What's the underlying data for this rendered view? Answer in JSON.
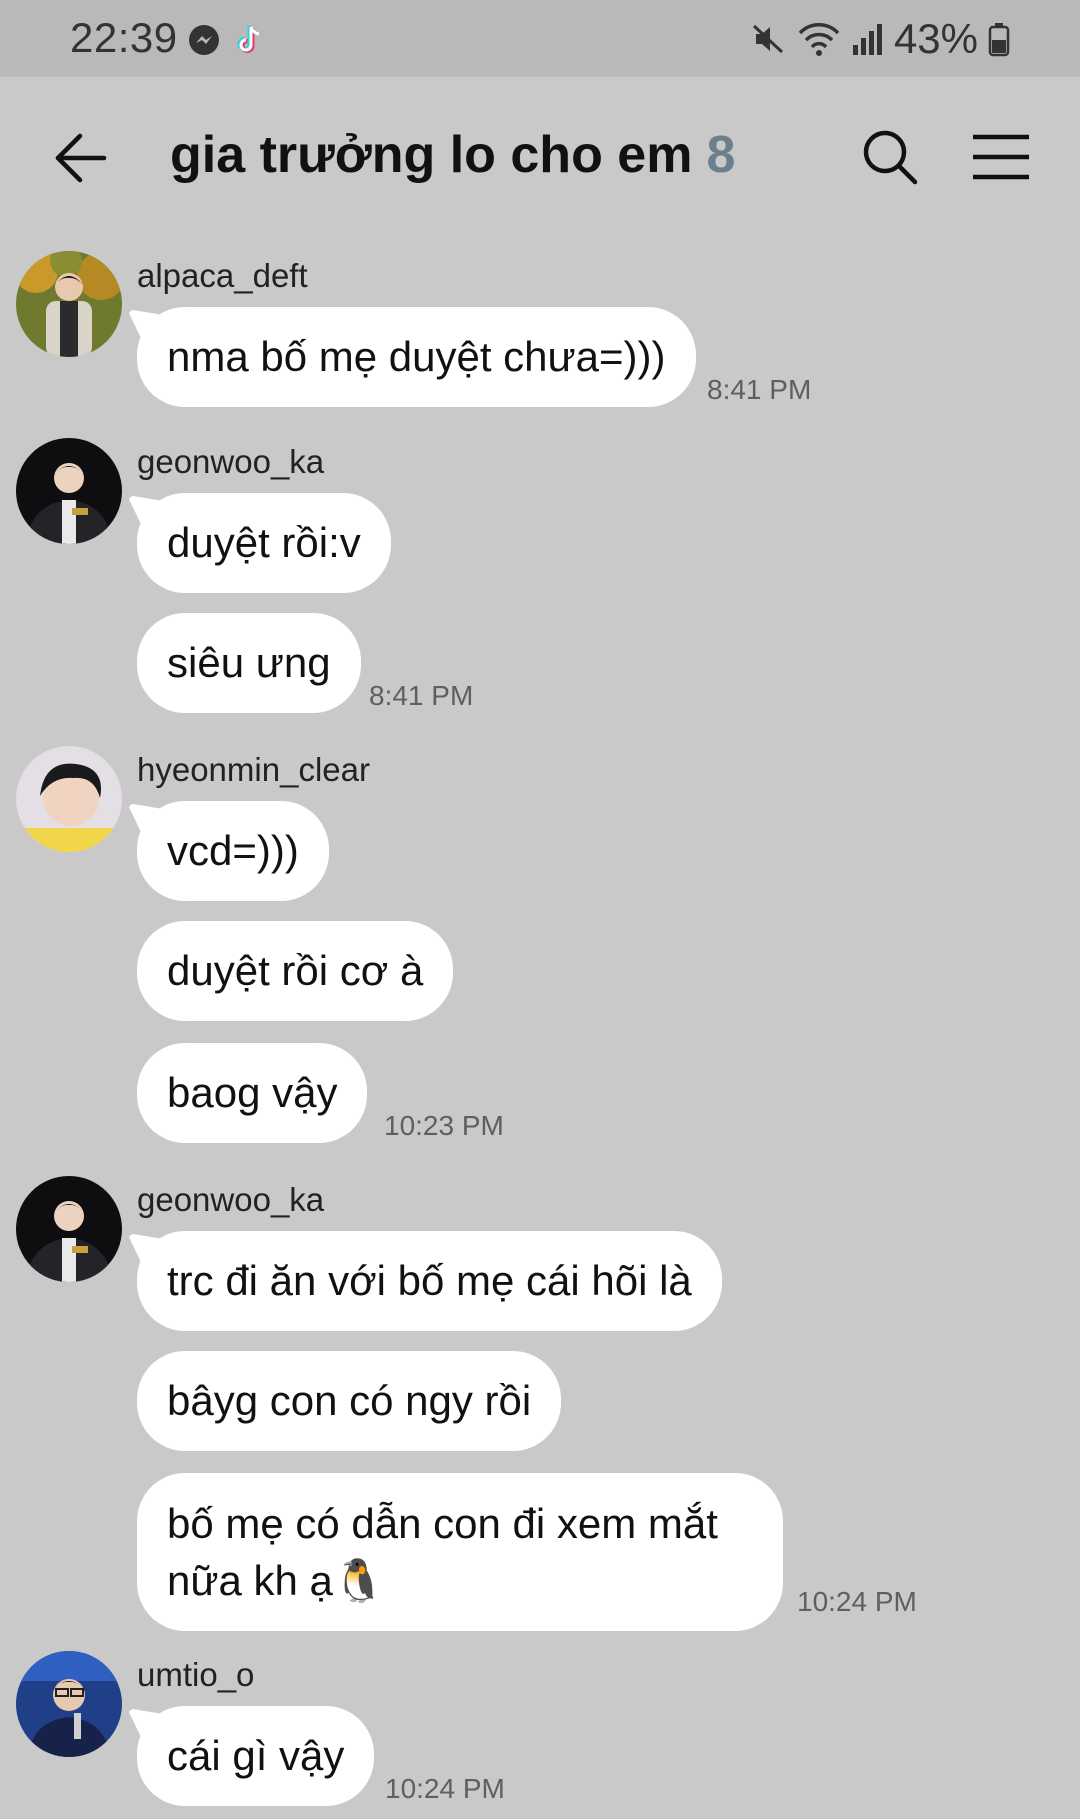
{
  "status_bar": {
    "time": "22:39",
    "battery": "43%",
    "icons": [
      "messenger-icon",
      "tiktok-icon",
      "mute-icon",
      "wifi-icon",
      "signal-icon",
      "battery-icon"
    ]
  },
  "header": {
    "title": "gia trưởng lo cho em",
    "member_count": "8",
    "icons": [
      "back-arrow-icon",
      "search-icon",
      "menu-icon"
    ]
  },
  "messages": [
    {
      "username": "alpaca_deft",
      "bubbles": [
        "nma bố mẹ duyệt chưa=)))"
      ],
      "time": "8:41 PM"
    },
    {
      "username": "geonwoo_ka",
      "bubbles": [
        "duyệt rồi:v",
        "siêu ưng"
      ],
      "time": "8:41 PM"
    },
    {
      "username": "hyeonmin_clear",
      "bubbles": [
        "vcd=)))",
        "duyệt rồi cơ à",
        "baog vậy"
      ],
      "time": "10:23 PM"
    },
    {
      "username": "geonwoo_ka",
      "bubbles": [
        "trc đi ăn với bố mẹ cái hõi là",
        "bâyg con có ngy rồi",
        "bố mẹ có dẫn con đi xem mắt nữa kh ạ🐧"
      ],
      "time": "10:24 PM"
    },
    {
      "username": "umtio_o",
      "bubbles": [
        "cái gì vậy"
      ],
      "time": "10:24 PM"
    }
  ],
  "colors": {
    "background": "#c9c9ca",
    "status_bar": "#b9b9ba",
    "bubble": "#ffffff",
    "member_count": "#6b7f8c",
    "timestamp": "#5f5f60"
  }
}
